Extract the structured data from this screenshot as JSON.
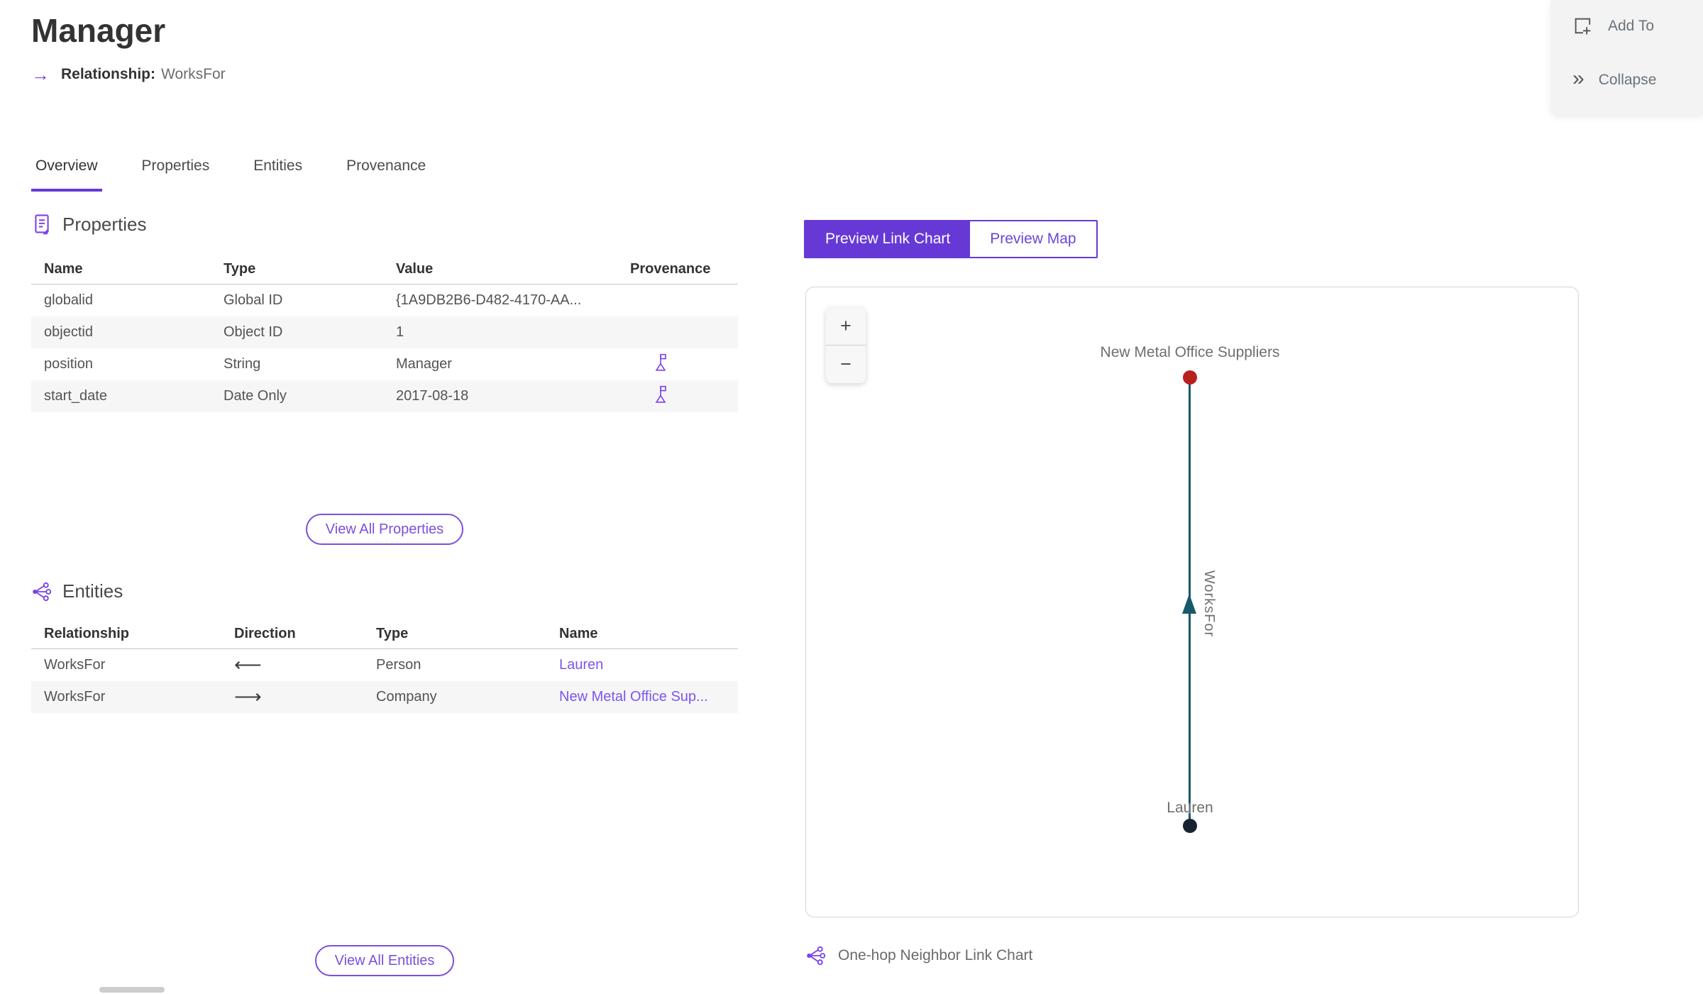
{
  "header": {
    "title": "Manager",
    "relationship_icon": "→",
    "relationship_label": "Relationship:",
    "relationship_value": "WorksFor"
  },
  "actions": {
    "add_to": "Add To",
    "collapse": "Collapse",
    "collapse_icon": "»"
  },
  "tabs": [
    {
      "label": "Overview",
      "active": true
    },
    {
      "label": "Properties",
      "active": false
    },
    {
      "label": "Entities",
      "active": false
    },
    {
      "label": "Provenance",
      "active": false
    }
  ],
  "properties_section": {
    "title": "Properties",
    "columns": [
      "Name",
      "Type",
      "Value",
      "Provenance"
    ],
    "rows": [
      {
        "name": "globalid",
        "type": "Global ID",
        "value": "{1A9DB2B6-D482-4170-AA...",
        "provenance": false
      },
      {
        "name": "objectid",
        "type": "Object ID",
        "value": "1",
        "provenance": false
      },
      {
        "name": "position",
        "type": "String",
        "value": "Manager",
        "provenance": true
      },
      {
        "name": "start_date",
        "type": "Date Only",
        "value": "2017-08-18",
        "provenance": true
      }
    ],
    "view_all_label": "View All Properties"
  },
  "entities_section": {
    "title": "Entities",
    "columns": [
      "Relationship",
      "Direction",
      "Type",
      "Name"
    ],
    "rows": [
      {
        "relationship": "WorksFor",
        "direction_glyph": "⟵",
        "type": "Person",
        "name": "Lauren"
      },
      {
        "relationship": "WorksFor",
        "direction_glyph": "⟶",
        "type": "Company",
        "name": "New Metal Office Sup..."
      }
    ],
    "view_all_label": "View All Entities"
  },
  "preview": {
    "segments": [
      {
        "label": "Preview Link Chart",
        "active": true
      },
      {
        "label": "Preview Map",
        "active": false
      }
    ],
    "zoom_in": "+",
    "zoom_out": "−",
    "caption": "One-hop Neighbor Link Chart"
  },
  "link_chart": {
    "type": "link-chart",
    "nodes": [
      {
        "label": "New Metal Office Suppliers",
        "color": "#b91f1c",
        "position": "top"
      },
      {
        "label": "Lauren",
        "color": "#17242f",
        "position": "bottom"
      }
    ],
    "edges": [
      {
        "label": "WorksFor",
        "from": "Lauren",
        "to": "New Metal Office Suppliers",
        "color": "#17596b",
        "direction": "up"
      }
    ]
  },
  "colors": {
    "accent": "#6639d6",
    "link": "#7c55ee",
    "edge": "#17596b",
    "node_top": "#b91f1c",
    "node_bottom": "#17242f",
    "panel_bg": "#f3f3f4"
  }
}
